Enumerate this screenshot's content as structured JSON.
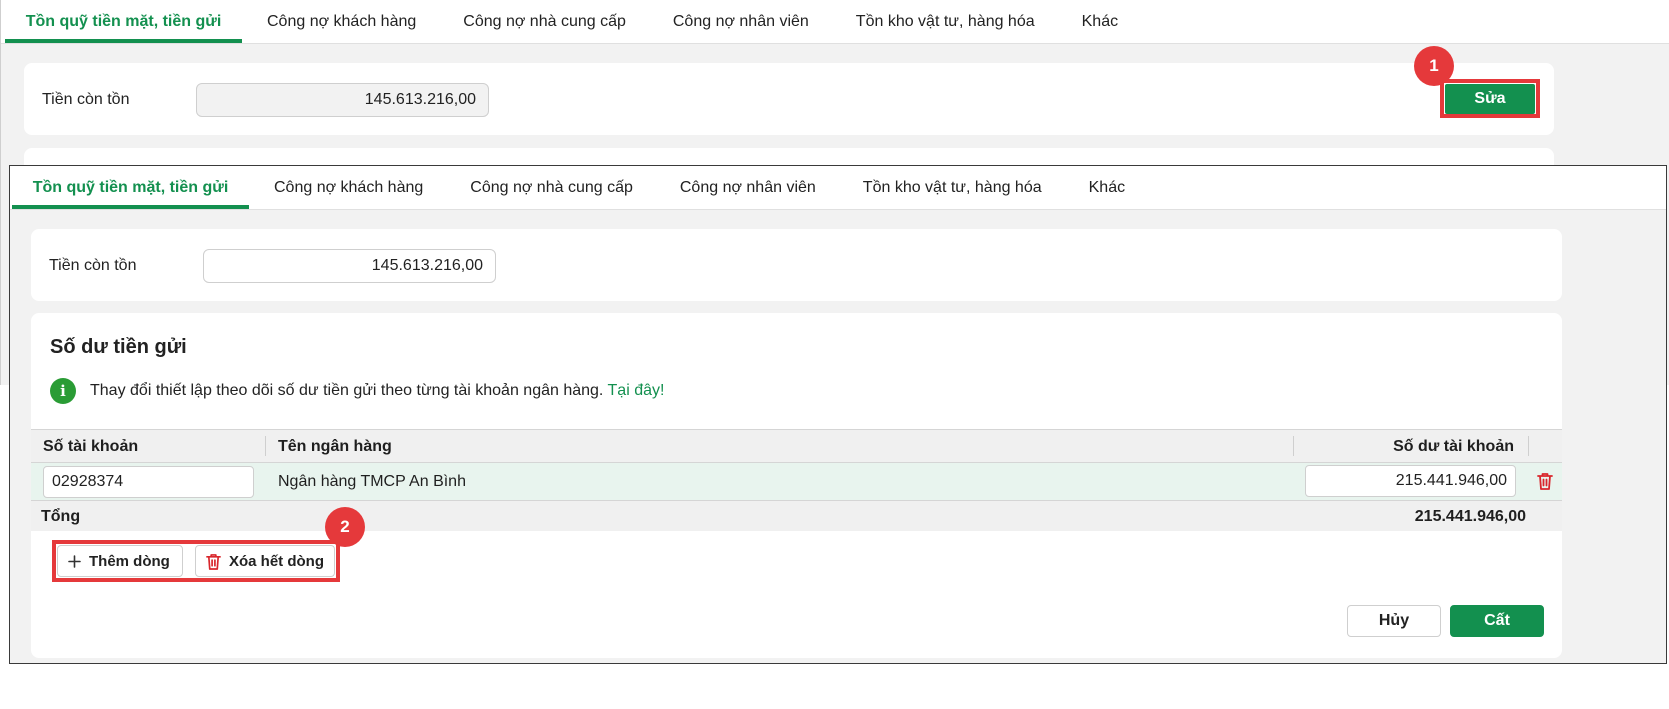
{
  "tabs": [
    {
      "label": "Tồn quỹ tiền mặt, tiền gửi",
      "active": true
    },
    {
      "label": "Công nợ khách hàng",
      "active": false
    },
    {
      "label": "Công nợ nhà cung cấp",
      "active": false
    },
    {
      "label": "Công nợ nhân viên",
      "active": false
    },
    {
      "label": "Tồn kho vật tư, hàng hóa",
      "active": false
    },
    {
      "label": "Khác",
      "active": false
    }
  ],
  "cash": {
    "label": "Tiền còn tồn",
    "value": "145.613.216,00"
  },
  "edit_button": "Sửa",
  "steps": {
    "one": "1",
    "two": "2"
  },
  "deposit_section": {
    "title": "Số dư tiền gửi",
    "info_text": "Thay đổi thiết lập theo dõi số dư tiền gửi theo từng tài khoản ngân hàng.",
    "info_link": "Tại đây!"
  },
  "table": {
    "columns": [
      "Số tài khoản",
      "Tên ngân hàng",
      "Số dư tài khoản"
    ],
    "rows": [
      {
        "account": "02928374",
        "bank": "Ngân hàng TMCP An Bình",
        "balance": "215.441.946,00"
      }
    ],
    "total_label": "Tổng",
    "total_value": "215.441.946,00"
  },
  "row_actions": {
    "add": "Thêm dòng",
    "clear": "Xóa hết dòng"
  },
  "footer": {
    "cancel": "Hủy",
    "save": "Cất"
  },
  "colors": {
    "primary": "#13904f",
    "highlight": "#e5393b",
    "delete": "#d9262c"
  },
  "icons": [
    "plus-icon",
    "trash-icon",
    "info-icon"
  ]
}
